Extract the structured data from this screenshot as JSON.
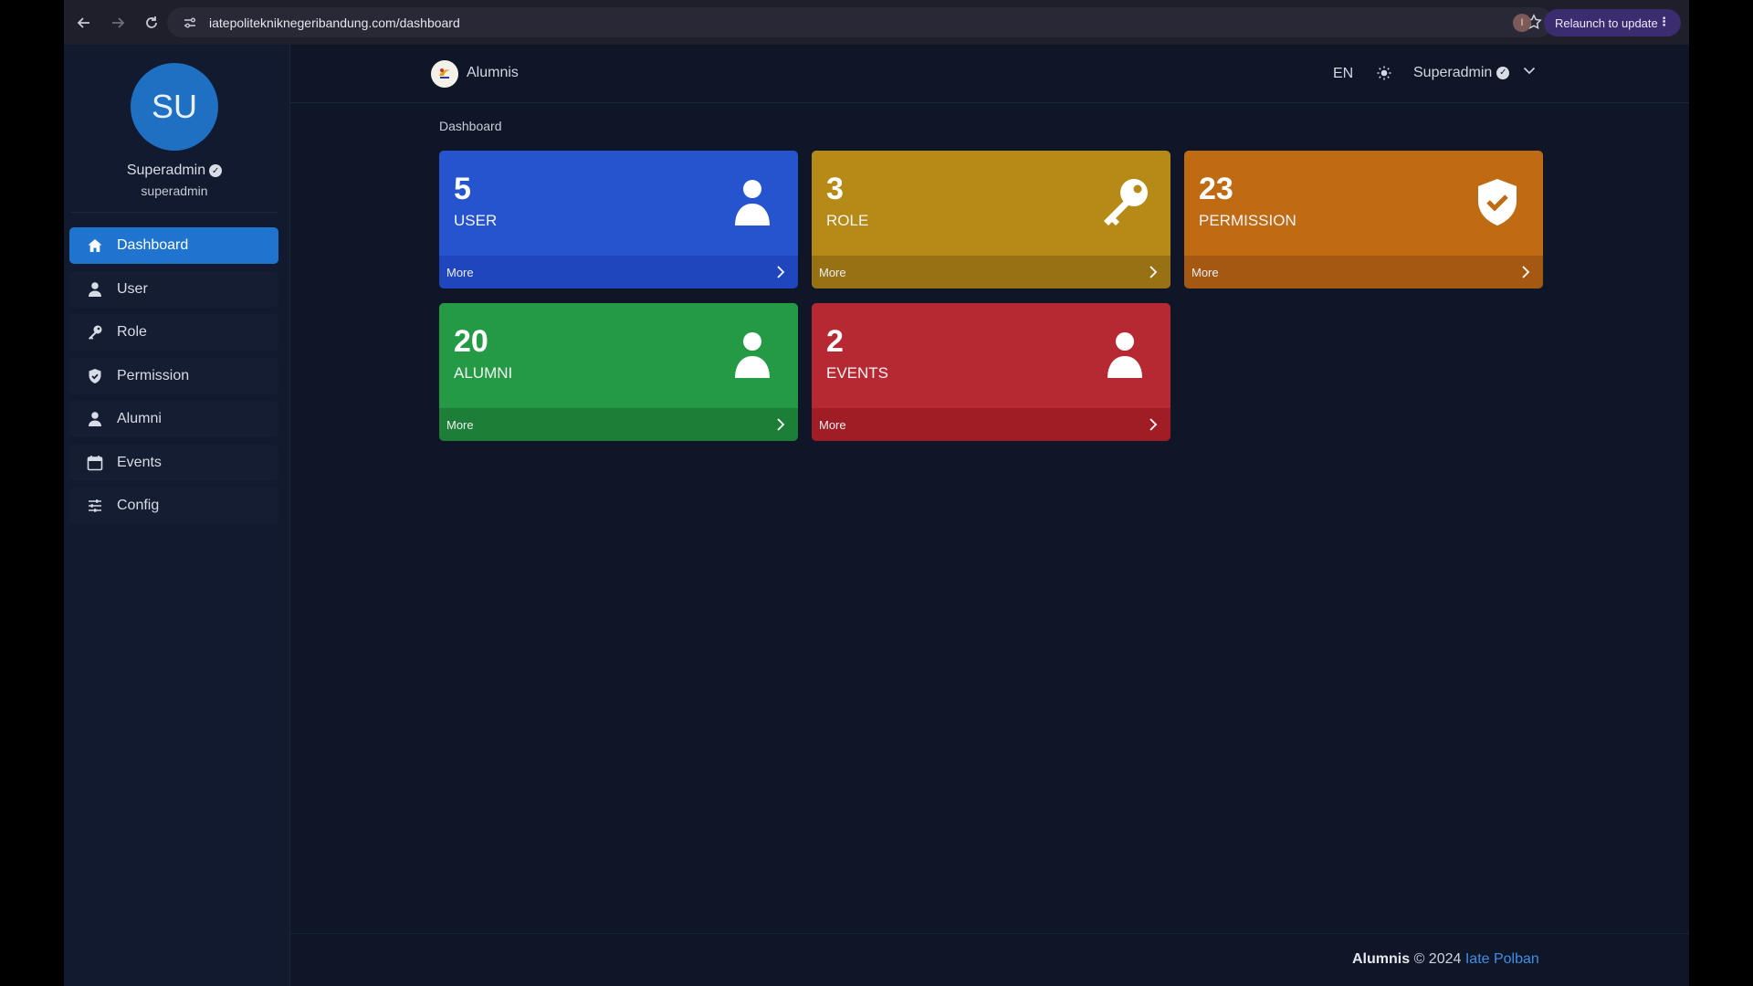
{
  "browser": {
    "url": "iatepoliteknikneger ibandung.com/dashboard",
    "profile_initial": "I",
    "relaunch_label": "Relaunch to update"
  },
  "sidebar": {
    "avatar_initials": "SU",
    "user_name": "Superadmin",
    "user_handle": "superadmin",
    "items": [
      {
        "label": "Dashboard",
        "icon": "home-icon",
        "active": true
      },
      {
        "label": "User",
        "icon": "user-icon"
      },
      {
        "label": "Role",
        "icon": "key-icon"
      },
      {
        "label": "Permission",
        "icon": "shield-icon"
      },
      {
        "label": "Alumni",
        "icon": "user-icon"
      },
      {
        "label": "Events",
        "icon": "calendar-icon"
      },
      {
        "label": "Config",
        "icon": "sliders-icon"
      }
    ]
  },
  "topnav": {
    "brand": "Alumnis",
    "lang": "EN",
    "user": "Superadmin"
  },
  "breadcrumb": "Dashboard",
  "cards": [
    {
      "count": "5",
      "label": "USER",
      "more": "More",
      "icon": "user-icon",
      "color": "#2654cf"
    },
    {
      "count": "3",
      "label": "ROLE",
      "more": "More",
      "icon": "key-icon",
      "color": "#b58a16"
    },
    {
      "count": "23",
      "label": "PERMISSION",
      "more": "More",
      "icon": "shield-check-icon",
      "color": "#bf6b14"
    },
    {
      "count": "20",
      "label": "ALUMNI",
      "more": "More",
      "icon": "user-icon",
      "color": "#249a44"
    },
    {
      "count": "2",
      "label": "EVENTS",
      "more": "More",
      "icon": "user-icon",
      "color": "#b62932"
    }
  ],
  "footer": {
    "brand": "Alumnis",
    "copy": " © 2024 ",
    "link": "Iate Polban"
  }
}
